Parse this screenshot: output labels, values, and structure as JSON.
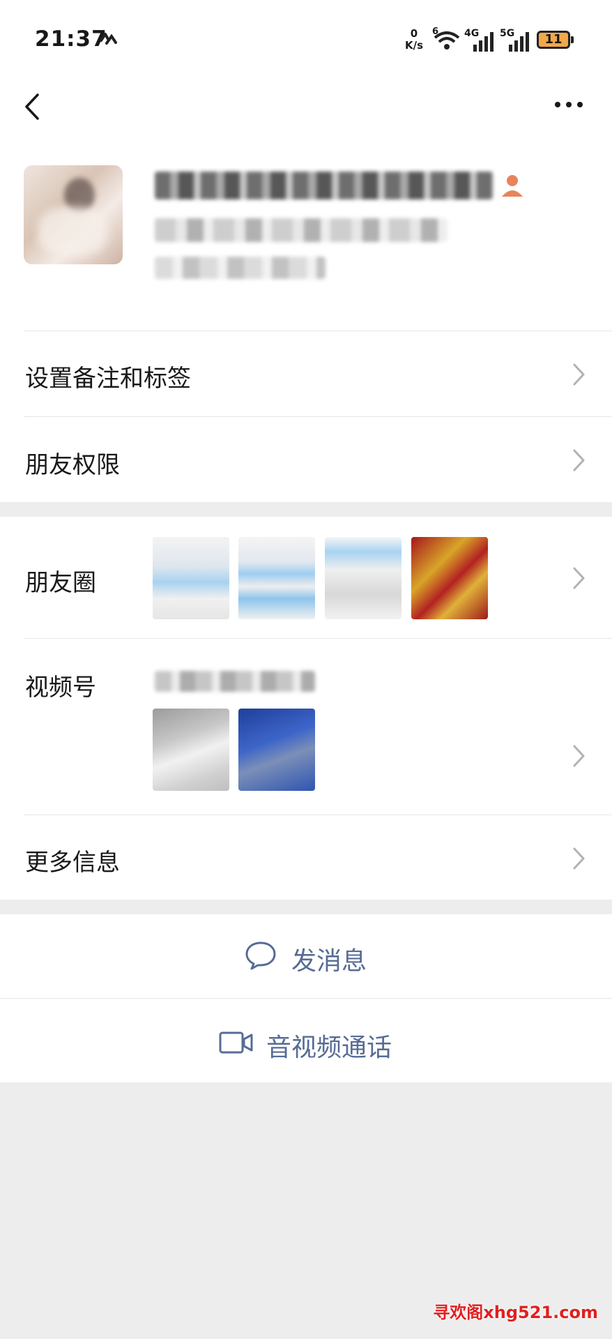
{
  "status_bar": {
    "time": "21:37",
    "net_speed_value": "0",
    "net_speed_unit": "K/s",
    "sim1_label": "4G",
    "sim2_label": "5G",
    "wifi_label": "6",
    "battery_level": "11"
  },
  "header": {
    "back_icon": "chevron-left-icon",
    "more_icon": "more-dots-icon",
    "badge_icon": "user-badge-icon",
    "badge_color": "#e8845c"
  },
  "menu": {
    "remark_tags": "设置备注和标签",
    "friend_permissions": "朋友权限",
    "moments": "朋友圈",
    "channels": "视频号",
    "more_info": "更多信息"
  },
  "actions": {
    "send_message": "发消息",
    "call": "音视频通话",
    "send_message_icon": "chat-bubble-icon",
    "call_icon": "video-camera-icon",
    "accent_color": "#576b95"
  },
  "watermark": "寻欢阁xhg521.com"
}
